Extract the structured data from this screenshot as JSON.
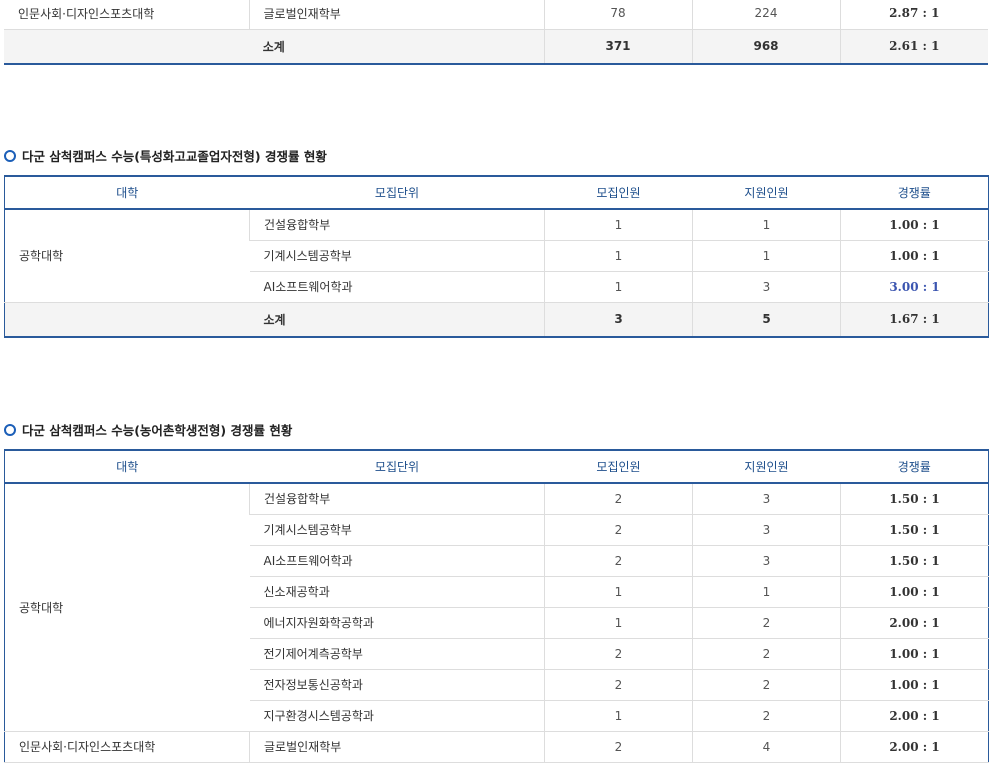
{
  "top_table": {
    "rows": [
      {
        "univ": "인문사회·디자인스포츠대학",
        "unit": "글로벌인재학부",
        "quota": "78",
        "applicants": "224",
        "rate": "2.87 : 1"
      }
    ],
    "subtotal": {
      "label": "소계",
      "quota": "371",
      "applicants": "968",
      "rate": "2.61 : 1"
    }
  },
  "section2": {
    "title": "다군 삼척캠퍼스 수능(특성화고교졸업자전형) 경쟁률 현황",
    "headers": {
      "univ": "대학",
      "unit": "모집단위",
      "quota": "모집인원",
      "applicants": "지원인원",
      "rate": "경쟁률"
    },
    "univ": "공학대학",
    "rows": [
      {
        "unit": "건설융합학부",
        "quota": "1",
        "applicants": "1",
        "rate": "1.00 : 1"
      },
      {
        "unit": "기계시스템공학부",
        "quota": "1",
        "applicants": "1",
        "rate": "1.00 : 1"
      },
      {
        "unit": "AI소프트웨어학과",
        "quota": "1",
        "applicants": "3",
        "rate": "3.00 : 1"
      }
    ],
    "subtotal": {
      "label": "소계",
      "quota": "3",
      "applicants": "5",
      "rate": "1.67 : 1"
    }
  },
  "section3": {
    "title": "다군 삼척캠퍼스 수능(농어촌학생전형) 경쟁률 현황",
    "headers": {
      "univ": "대학",
      "unit": "모집단위",
      "quota": "모집인원",
      "applicants": "지원인원",
      "rate": "경쟁률"
    },
    "univ_engineering": "공학대학",
    "rows": [
      {
        "unit": "건설융합학부",
        "quota": "2",
        "applicants": "3",
        "rate": "1.50 : 1"
      },
      {
        "unit": "기계시스템공학부",
        "quota": "2",
        "applicants": "3",
        "rate": "1.50 : 1"
      },
      {
        "unit": "AI소프트웨어학과",
        "quota": "2",
        "applicants": "3",
        "rate": "1.50 : 1"
      },
      {
        "unit": "신소재공학과",
        "quota": "1",
        "applicants": "1",
        "rate": "1.00 : 1"
      },
      {
        "unit": "에너지자원화학공학과",
        "quota": "1",
        "applicants": "2",
        "rate": "2.00 : 1"
      },
      {
        "unit": "전기제어계측공학부",
        "quota": "2",
        "applicants": "2",
        "rate": "1.00 : 1"
      },
      {
        "unit": "전자정보통신공학과",
        "quota": "2",
        "applicants": "2",
        "rate": "1.00 : 1"
      },
      {
        "unit": "지구환경시스템공학과",
        "quota": "1",
        "applicants": "2",
        "rate": "2.00 : 1"
      }
    ],
    "last_row": {
      "univ": "인문사회·디자인스포츠대학",
      "unit": "글로벌인재학부",
      "quota": "2",
      "applicants": "4",
      "rate": "2.00 : 1"
    }
  },
  "colors": {
    "accent": "#2a5a9b",
    "header_text": "#1e4f8c",
    "highlight_rate": "#3b55b0",
    "bullet": "#1c5fb8"
  }
}
